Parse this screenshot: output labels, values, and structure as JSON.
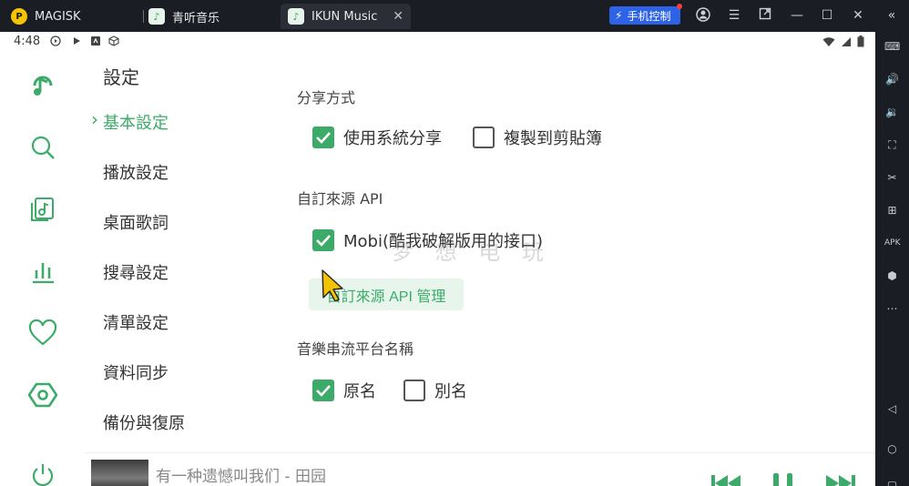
{
  "titlebar": {
    "tabs": [
      {
        "label": "MAGISK",
        "icon": "magisk-icon"
      },
      {
        "label": "青听音乐",
        "icon": "music-app-icon"
      },
      {
        "label": "IKUN Music",
        "icon": "music-app-icon",
        "active": true
      }
    ],
    "phone_control_label": "手机控制",
    "icons": [
      "account-icon",
      "menu-icon",
      "popout-icon",
      "minimize-icon",
      "maximize-icon",
      "close-icon",
      "collapse-sidebar-icon"
    ]
  },
  "statusbar": {
    "time": "4:48",
    "icons": [
      "play-circle-icon",
      "play-icon",
      "storage-icon",
      "cube-icon",
      "wifi-icon",
      "signal-icon",
      "battery-icon"
    ]
  },
  "nav": {
    "items": [
      "logo-icon",
      "search-icon",
      "song-list-icon",
      "leaderboard-icon",
      "favorite-icon",
      "settings-icon",
      "power-icon"
    ],
    "active": "settings-icon"
  },
  "menu": {
    "title": "設定",
    "items": [
      {
        "label": "基本設定",
        "active": true
      },
      {
        "label": "播放設定"
      },
      {
        "label": "桌面歌詞"
      },
      {
        "label": "搜尋設定"
      },
      {
        "label": "清單設定"
      },
      {
        "label": "資料同步"
      },
      {
        "label": "備份與復原"
      }
    ]
  },
  "content": {
    "share_heading": "分享方式",
    "share_options": [
      {
        "label": "使用系統分享",
        "checked": true
      },
      {
        "label": "複製到剪貼簿",
        "checked": false
      }
    ],
    "api_heading": "自訂來源 API",
    "api_options": [
      {
        "label": "Mobi(酷我破解版用的接口)",
        "checked": true
      }
    ],
    "api_button": "自訂來源 API 管理",
    "platform_heading": "音樂串流平台名稱",
    "platform_options": [
      {
        "label": "原名",
        "checked": true
      },
      {
        "label": "別名",
        "checked": false
      }
    ],
    "watermark": "梦  想  电  玩"
  },
  "player": {
    "song": "有一种遗憾叫我们 - 田园",
    "controls": [
      "previous-icon",
      "pause-icon",
      "next-icon"
    ]
  },
  "sidebar": {
    "icons": [
      "keyboard-icon",
      "volume-up-icon",
      "volume-down-icon",
      "screenshot-icon",
      "scissors-icon",
      "add-icon",
      "apk-icon",
      "settings-gear-icon",
      "more-icon",
      "back-icon",
      "home-icon",
      "recents-icon"
    ]
  },
  "colors": {
    "accent": "#3cab6a",
    "titlebar": "#1b1d24",
    "phone_control": "#2e63e8"
  }
}
